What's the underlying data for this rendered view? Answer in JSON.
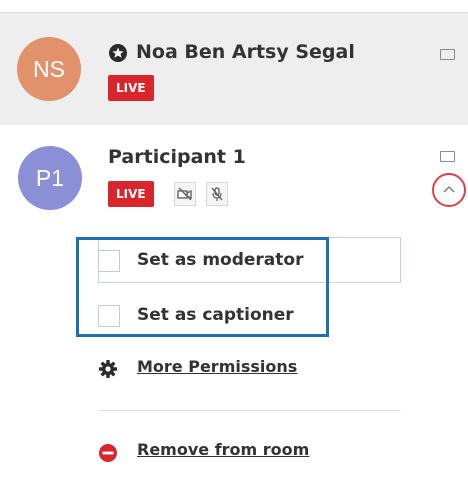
{
  "participants": [
    {
      "initials": "NS",
      "avatar_color": "#e2926a",
      "name": "Noa Ben Artsy Segal",
      "badge": "LIVE",
      "role_icon": "moderator-icon"
    },
    {
      "initials": "P1",
      "avatar_color": "#8b8fd6",
      "name": "Participant 1",
      "badge": "LIVE",
      "status_icons": [
        "camera-off-icon",
        "microphone-off-icon"
      ],
      "expanded": true
    }
  ],
  "permissions": {
    "options": [
      {
        "label": "Set as moderator",
        "checked": false
      },
      {
        "label": "Set as captioner",
        "checked": false
      }
    ],
    "more_label": "More Permissions",
    "remove_label": "Remove from room"
  },
  "colors": {
    "live_badge": "#d9262c",
    "highlight_box": "#1f6fb5",
    "chevron_circle": "#d9434b",
    "remove_icon": "#d9262c"
  }
}
